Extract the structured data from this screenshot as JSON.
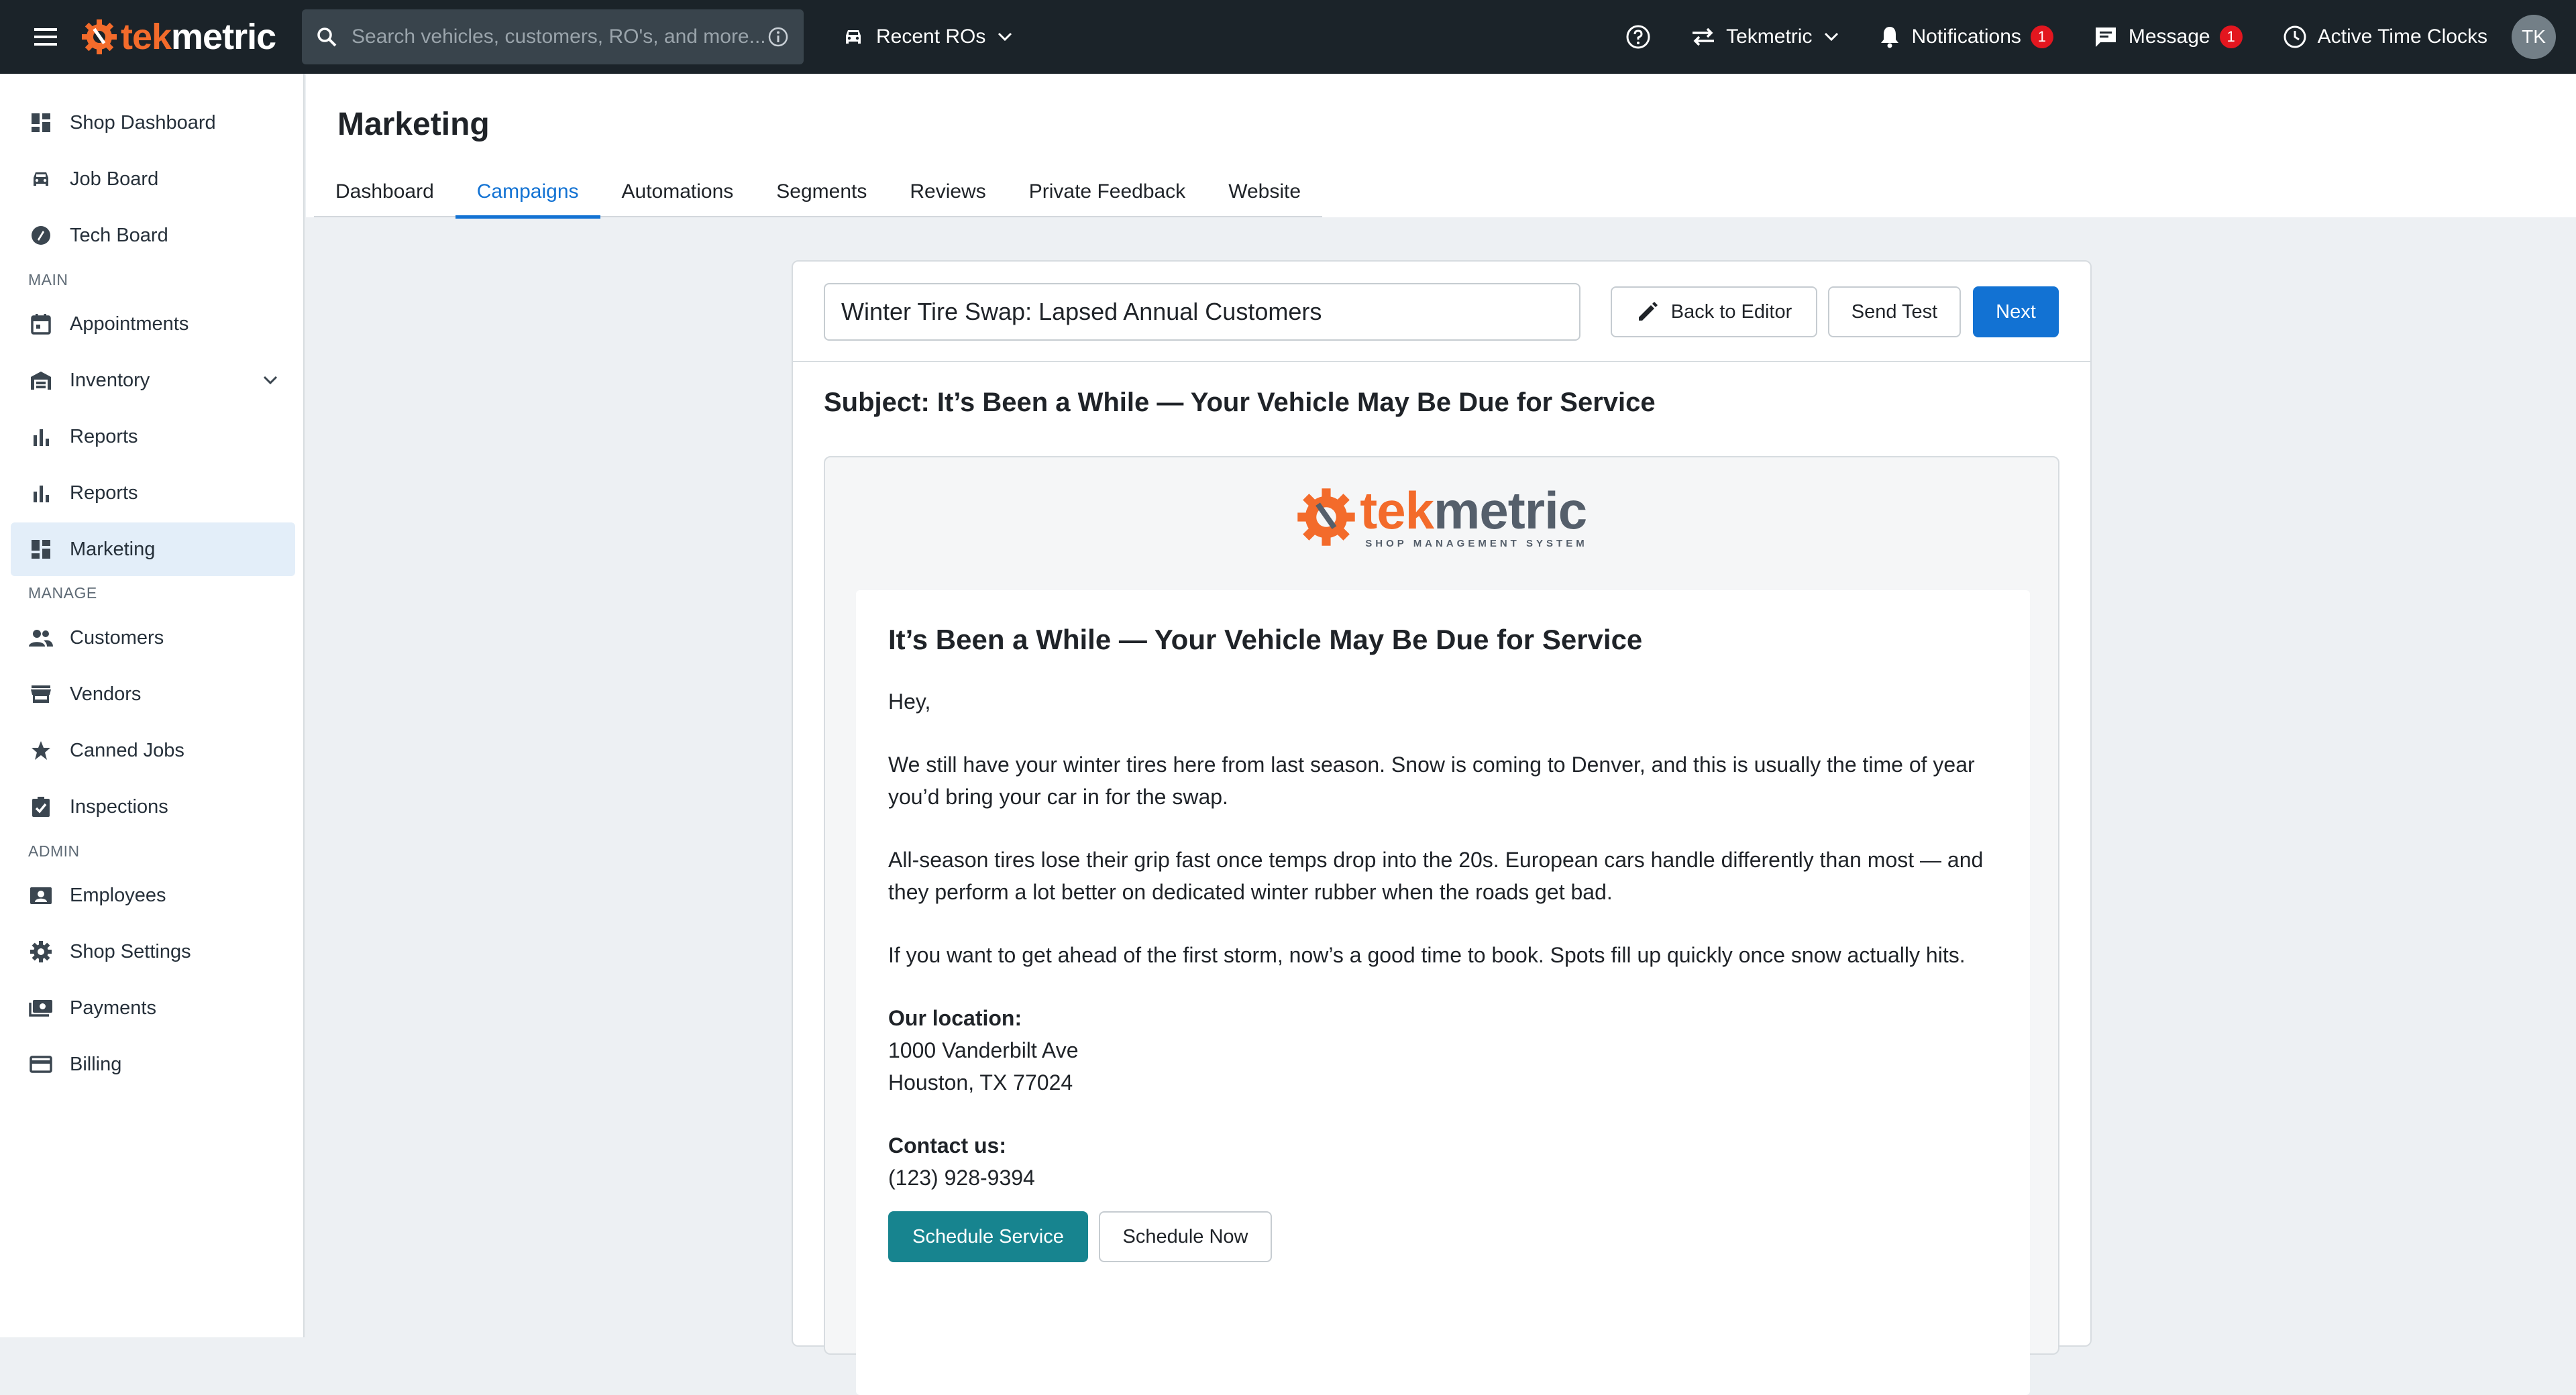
{
  "topbar": {
    "logo": {
      "part1": "tek",
      "part2": "metric"
    },
    "search_placeholder": "Search vehicles, customers, RO's, and more...",
    "recent_label": "Recent ROs",
    "shop_label": "Tekmetric",
    "notifications_label": "Notifications",
    "notifications_count": "1",
    "message_label": "Message",
    "message_count": "1",
    "time_clocks_label": "Active Time Clocks",
    "avatar_initials": "TK"
  },
  "sidebar": {
    "items_top": [
      "Shop Dashboard",
      "Job Board",
      "Tech Board"
    ],
    "section_main": "MAIN",
    "items_main": [
      "Appointments",
      "Inventory",
      "Reports",
      "Reports",
      "Marketing"
    ],
    "section_manage": "MANAGE",
    "items_manage": [
      "Customers",
      "Vendors",
      "Canned Jobs",
      "Inspections"
    ],
    "section_admin": "ADMIN",
    "items_admin": [
      "Employees",
      "Shop Settings",
      "Payments",
      "Billing"
    ],
    "active": "Marketing"
  },
  "header": {
    "title": "Marketing",
    "tabs": [
      "Dashboard",
      "Campaigns",
      "Automations",
      "Segments",
      "Reviews",
      "Private Feedback",
      "Website"
    ],
    "active_tab": "Campaigns"
  },
  "campaign": {
    "name": "Winter Tire Swap: Lapsed Annual Customers",
    "back_label": "Back to Editor",
    "send_test_label": "Send Test",
    "next_label": "Next",
    "subject": "Subject: It’s Been a While — Your Vehicle May Be Due for Service"
  },
  "email": {
    "logo": {
      "part1": "tek",
      "part2": "metric",
      "tagline": "SHOP MANAGEMENT SYSTEM"
    },
    "heading": "It’s Been a While — Your Vehicle May Be Due for Service",
    "greeting": "Hey,",
    "p1": "We still have your winter tires here from last season. Snow is coming to Denver, and this is usually the time of year you’d bring your car in for the swap.",
    "p2": "All-season tires lose their grip fast once temps drop into the 20s. European cars handle differently than most — and they perform a lot better on dedicated winter rubber when the roads get bad.",
    "p3": "If you want to get ahead of the first storm, now’s a good time to book. Spots fill up quickly once snow actually hits.",
    "location_label": "Our location:",
    "address_line1": "1000 Vanderbilt Ave",
    "address_line2": "Houston, TX 77024",
    "contact_label": "Contact us:",
    "phone": "(123) 928-9394",
    "btn_schedule_service": "Schedule Service",
    "btn_schedule_now": "Schedule Now"
  },
  "colors": {
    "topbar_bg": "#1b2329",
    "brand_orange": "#f36b2b",
    "primary_blue": "#1272d3",
    "teal": "#17848f",
    "badge_red": "#e3161f"
  }
}
